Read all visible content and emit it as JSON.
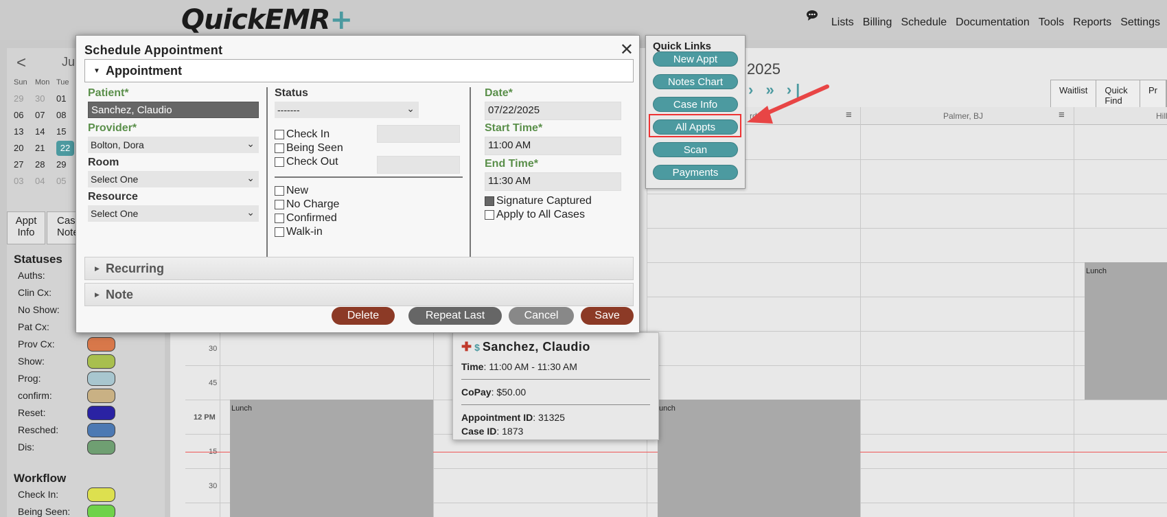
{
  "header": {
    "logo_text": "QuickEMR",
    "logo_plus": "+",
    "nav": [
      "Lists",
      "Billing",
      "Schedule",
      "Documentation",
      "Tools",
      "Reports",
      "Settings"
    ]
  },
  "mini_calendar": {
    "prev": "<",
    "month": "Ju",
    "dows": [
      "Sun",
      "Mon",
      "Tue"
    ],
    "rows": [
      [
        "29",
        "30",
        "01"
      ],
      [
        "06",
        "07",
        "08"
      ],
      [
        "13",
        "14",
        "15"
      ],
      [
        "20",
        "21",
        "22"
      ],
      [
        "27",
        "28",
        "29"
      ],
      [
        "03",
        "04",
        "05"
      ]
    ],
    "selected": "22"
  },
  "side_tabs": {
    "appt_info": "Appt Info",
    "case_notes": "Case Notes"
  },
  "statuses": {
    "heading": "Statuses",
    "items": [
      {
        "label": "Auths:",
        "color": ""
      },
      {
        "label": "Clin Cx:",
        "color": ""
      },
      {
        "label": "No Show:",
        "color": ""
      },
      {
        "label": "Pat Cx:",
        "color": ""
      },
      {
        "label": "Prov Cx:",
        "color": "#d8784a"
      },
      {
        "label": "Show:",
        "color": "#a8bf4e"
      },
      {
        "label": "Prog:",
        "color": "#a8c6cf"
      },
      {
        "label": "confirm:",
        "color": "#c9b184"
      },
      {
        "label": "Reset:",
        "color": "#2a22a3"
      },
      {
        "label": "Resched:",
        "color": "#4c79b3"
      },
      {
        "label": "Dis:",
        "color": "#6f9f72"
      }
    ]
  },
  "workflow": {
    "heading": "Workflow",
    "items": [
      {
        "label": "Check In:",
        "color": "#dde04f"
      },
      {
        "label": "Being Seen:",
        "color": "#6fd24a"
      }
    ]
  },
  "schedule": {
    "date_title": "2025",
    "nav_arrows": "› » ›|",
    "buttons": [
      "Waitlist",
      "Quick Find",
      "Pr"
    ],
    "columns": [
      "rd",
      "Palmer, BJ",
      "Hill"
    ],
    "times": [
      {
        "label": "30",
        "bold": false
      },
      {
        "label": "45",
        "bold": false
      },
      {
        "label": "12 PM",
        "bold": true
      },
      {
        "label": "15",
        "bold": false
      },
      {
        "label": "30",
        "bold": false
      }
    ],
    "lunch_label": "Lunch",
    "lunch_label_cut": "unch"
  },
  "appt_card": {
    "name": "Sanchez, Claudio",
    "time_label": "Time",
    "time_value": ": 11:00 AM - 11:30 AM",
    "copay_label": "CoPay",
    "copay_value": ": $50.00",
    "appt_id_label": "Appointment ID",
    "appt_id_value": ": 31325",
    "case_id_label": "Case ID",
    "case_id_value": ": 1873"
  },
  "quick_links": {
    "heading": "Quick Links",
    "items": [
      "New Appt",
      "Notes Chart",
      "Case Info",
      "All Appts",
      "Scan",
      "Payments"
    ],
    "highlighted": "All Appts"
  },
  "dialog": {
    "title": "Schedule Appointment",
    "section_appointment": "Appointment",
    "patient_label": "Patient*",
    "patient_value": "Sanchez, Claudio",
    "provider_label": "Provider*",
    "provider_value": "Bolton, Dora",
    "room_label": "Room",
    "room_value": "Select One",
    "resource_label": "Resource",
    "resource_value": "Select One",
    "status_label": "Status",
    "status_value": "-------",
    "checks_top": [
      "Check In",
      "Being Seen",
      "Check Out"
    ],
    "checks_bottom": [
      "New",
      "No Charge",
      "Confirmed",
      "Walk-in"
    ],
    "date_label": "Date*",
    "date_value": "07/22/2025",
    "start_label": "Start Time*",
    "start_value": "11:00 AM",
    "end_label": "End Time*",
    "end_value": "11:30 AM",
    "signature_label": "Signature Captured",
    "signature_checked": true,
    "apply_all_label": "Apply to All Cases",
    "section_recurring": "Recurring",
    "section_note": "Note",
    "buttons": {
      "delete": "Delete",
      "repeat_last": "Repeat Last",
      "cancel": "Cancel",
      "save": "Save"
    }
  }
}
